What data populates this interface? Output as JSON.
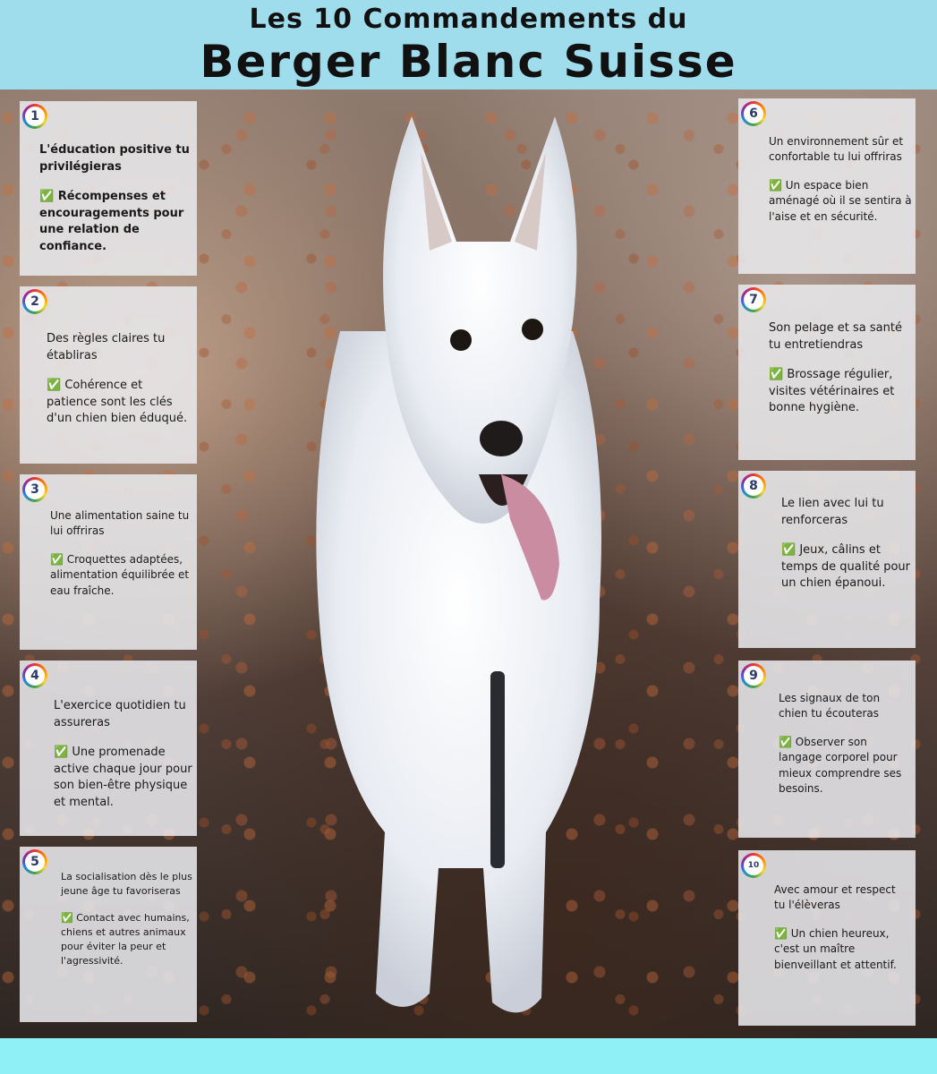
{
  "header": {
    "title_line1": "Les 10 Commandements du",
    "title_line2": "Berger Blanc Suisse"
  },
  "commandments": [
    {
      "number": "1",
      "title": "L'éducation positive tu privilégieras",
      "detail": "✅ Récompenses et encouragements pour une relation de confiance."
    },
    {
      "number": "2",
      "title": "Des règles claires tu établiras",
      "detail": "✅ Cohérence et patience sont les clés d'un chien bien éduqué."
    },
    {
      "number": "3",
      "title": "Une alimentation saine tu lui offriras",
      "detail": "✅ Croquettes adaptées, alimentation équilibrée et eau fraîche."
    },
    {
      "number": "4",
      "title": "L'exercice quotidien tu assureras",
      "detail": "✅ Une promenade active chaque jour pour son bien-être physique et mental."
    },
    {
      "number": "5",
      "title": "La socialisation dès le plus jeune âge tu favoriseras",
      "detail": "✅ Contact avec humains, chiens et autres animaux pour éviter la peur et l'agressivité."
    },
    {
      "number": "6",
      "title": "Un environnement sûr et confortable tu lui offriras",
      "detail": "✅ Un espace bien aménagé où il se sentira à l'aise et en sécurité."
    },
    {
      "number": "7",
      "title": "Son pelage et sa santé tu entretiendras",
      "detail": "✅ Brossage régulier, visites vétérinaires et bonne hygiène."
    },
    {
      "number": "8",
      "title": "Le lien avec lui tu renforceras",
      "detail": "✅ Jeux, câlins et temps de qualité pour un chien épanoui."
    },
    {
      "number": "9",
      "title": "Les signaux de ton chien tu écouteras",
      "detail": "✅ Observer son langage corporel pour mieux comprendre ses besoins."
    },
    {
      "number": "10",
      "title": "Avec amour et respect tu l'élèveras",
      "detail": "✅ Un chien heureux, c'est un maître bienveillant et attentif."
    }
  ]
}
